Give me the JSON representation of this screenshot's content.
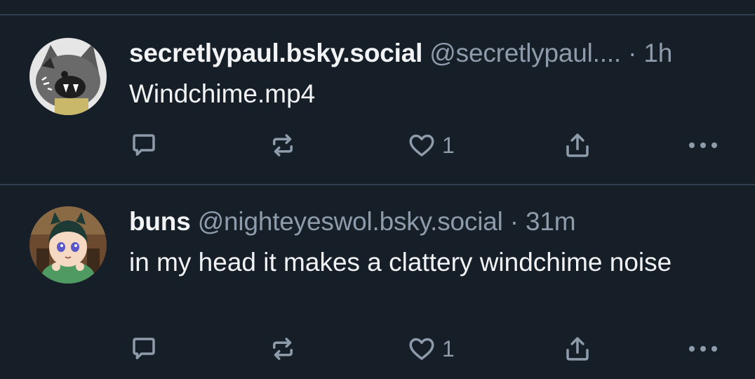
{
  "posts": [
    {
      "display_name": "secretlypaul.bsky.social",
      "handle": "@secretlypaul....",
      "separator": "·",
      "time": "1h",
      "text": "Windchime.mp4",
      "actions": {
        "like_count": "1"
      },
      "avatar_icon": "gray-cat-avatar"
    },
    {
      "display_name": "buns",
      "handle": "@nighteyeswol.bsky.social",
      "separator": "·",
      "time": "31m",
      "text": "in my head it makes a clattery windchime noise",
      "actions": {
        "like_count": "1"
      },
      "avatar_icon": "anime-character-avatar"
    }
  ],
  "colors": {
    "background": "#161e27",
    "divider": "#2e3d4f",
    "text_primary": "#f1f3f5",
    "text_secondary": "#8d9bab"
  }
}
